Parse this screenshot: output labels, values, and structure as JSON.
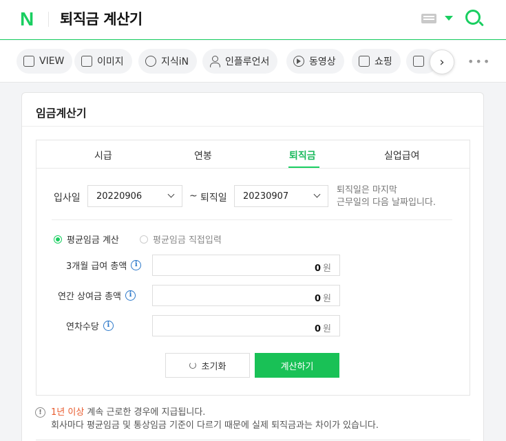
{
  "header": {
    "logo": "N",
    "query": "퇴직금 계산기"
  },
  "search_tabs": [
    {
      "label": "VIEW",
      "icon": "view-doc-icon"
    },
    {
      "label": "이미지",
      "icon": "image-icon"
    },
    {
      "label": "지식iN",
      "icon": "q-bubble-icon"
    },
    {
      "label": "인플루언서",
      "icon": "person-icon"
    },
    {
      "label": "동영상",
      "icon": "play-icon"
    },
    {
      "label": "쇼핑",
      "icon": "shopping-bag-icon"
    },
    {
      "label": "",
      "icon": "news-icon"
    }
  ],
  "card": {
    "title": "임금계산기",
    "tabs": [
      "시급",
      "연봉",
      "퇴직금",
      "실업급여"
    ],
    "active_tab": "퇴직금",
    "start_label": "입사일",
    "start_value": "20220906",
    "tilde": "~",
    "end_label": "퇴직일",
    "end_value": "20230907",
    "hint_line1": "퇴직일은 마지막",
    "hint_line2": "근무일의 다음 날짜입니다.",
    "radio_selected": "평균임금 계산",
    "radio_other": "평균임금 직접입력",
    "fields": [
      {
        "label": "3개월 급여 총액",
        "value": "0",
        "unit": "원"
      },
      {
        "label": "연간 상여금 총액",
        "value": "0",
        "unit": "원"
      },
      {
        "label": "연차수당",
        "value": "0",
        "unit": "원"
      }
    ],
    "reset_label": "초기화",
    "calc_label": "계산하기",
    "notice_highlight": "1년 이상",
    "notice_line1_rest": " 계속 근로한 경우에 지급됩니다.",
    "notice_line2": "회사마다 평균임금 및 통상임금 기준이 다르기 때문에 실제 퇴직금과는 차이가 있습니다."
  },
  "colors": {
    "brand_green": "#19ce60",
    "button_green": "#19c156",
    "info_blue": "#2a77c9",
    "highlight_red": "#e85a2c"
  }
}
